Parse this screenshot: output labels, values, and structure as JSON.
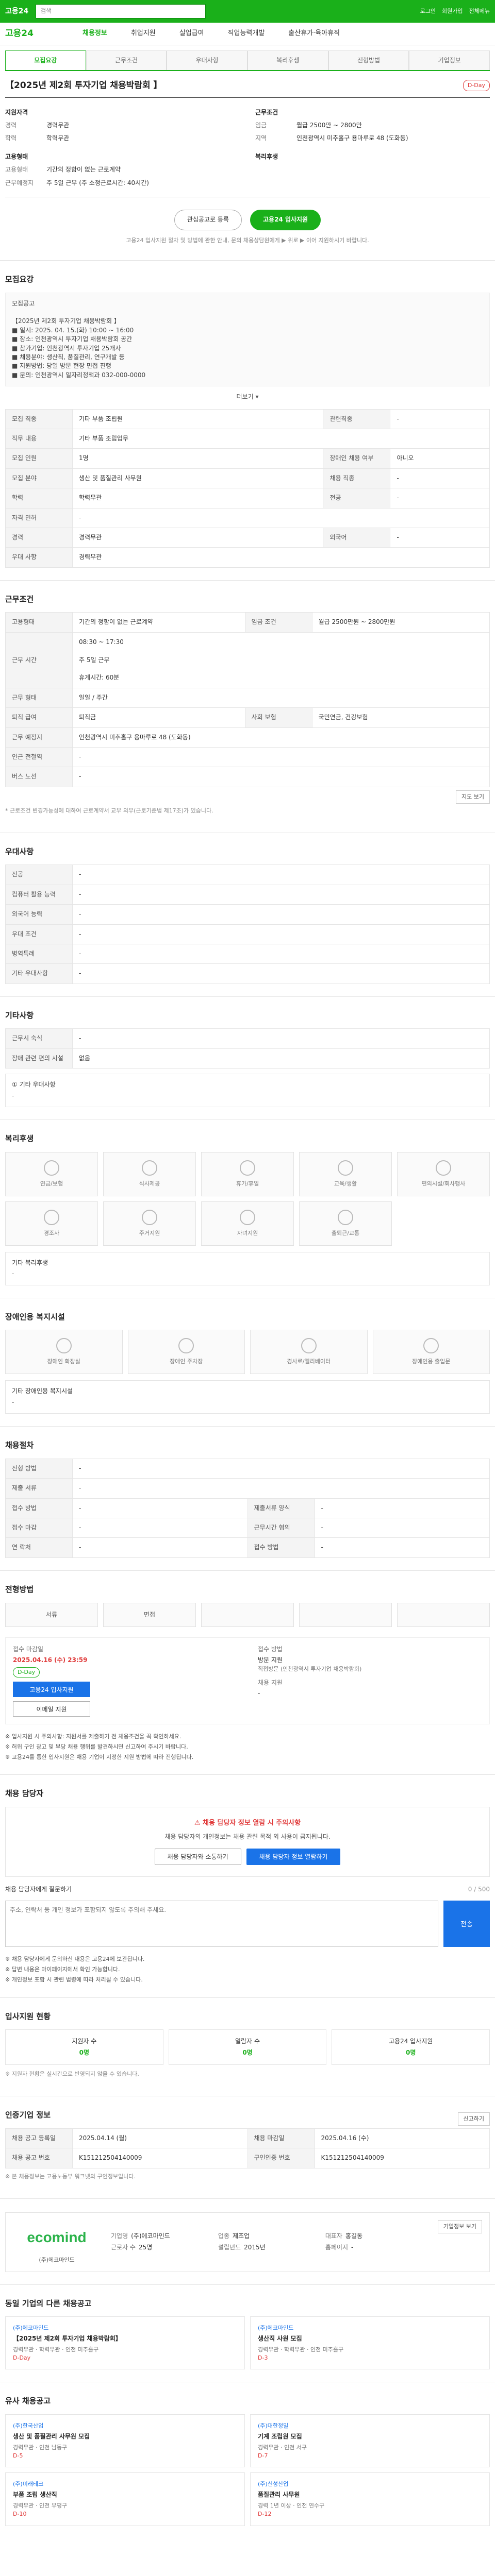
{
  "topbar": {
    "logo": "고용24",
    "search_placeholder": "검색",
    "links": [
      "로그인",
      "회원가입",
      "전체메뉴"
    ]
  },
  "gnb": {
    "logo": "고용24",
    "items": [
      "채용정보",
      "취업지원",
      "실업급여",
      "직업능력개발",
      "출산휴가·육아휴직"
    ],
    "active": 0
  },
  "tabs": [
    "모집요강",
    "근무조건",
    "우대사항",
    "복리후생",
    "전형방법",
    "기업정보"
  ],
  "headline": {
    "title": "【2025년 제2회 투자기업 채용박람회 】",
    "badge": "D-Day"
  },
  "summary": {
    "left_title": "지원자격",
    "left": [
      {
        "k": "경력",
        "v": "경력무관"
      },
      {
        "k": "학력",
        "v": "학력무관"
      }
    ],
    "left2_title": "고용형태",
    "left2": [
      {
        "k": "고용형태",
        "v": "기간의 정함이 없는 근로계약"
      },
      {
        "k": "근무예정지",
        "v": "주 5일 근무 (주 소정근로시간: 40시간)"
      }
    ],
    "right_title": "근무조건",
    "right": [
      {
        "k": "임금",
        "v": "월급 2500만 ~ 2800만"
      },
      {
        "k": "지역",
        "v": "인천광역시 미추홀구 용마루로 48 (도화동)"
      }
    ],
    "right2_title": "복리후생",
    "right2": []
  },
  "actions": {
    "save": "관심공고로 등록",
    "apply": "고용24 입사지원"
  },
  "actions_note": "고용24 입사지원 절차 및 방법에 관한 안내, 문의 채용상담원에게 ▶ 위로 ▶ 이어 지원하시기 바랍니다.",
  "recruit": {
    "title": "모집요강",
    "content": "모집공고\n\n【2025년 제2회 투자기업 채용박람회 】\n■ 일시: 2025. 04. 15.(화) 10:00 ~ 16:00\n■ 장소: 인천광역시 투자기업 채용박람회 공간\n■ 참가기업: 인천광역시 투자기업 25개사\n■ 채용분야: 생산직, 품질관리, 연구개발 등\n■ 지원방법: 당일 방문 현장 면접 진행\n■ 문의: 인천광역시 일자리정책과 032-000-0000",
    "more": "더보기 ▾",
    "rows": [
      {
        "k": "모집 직종",
        "v": "기타 부품 조립원",
        "k2": "관련직종",
        "v2": "-"
      },
      {
        "k": "직무 내용",
        "v": "기타 부품 조립업무",
        "k2": "",
        "v2": ""
      },
      {
        "k": "모집 인원",
        "v": "1명",
        "k2": "장애인 채용 여부",
        "v2": "아니오"
      },
      {
        "k": "모집 분야",
        "v": "생산 및 품질관리 사무원",
        "k2": "채용 직종",
        "v2": "-"
      },
      {
        "k": "학력",
        "v": "학력무관",
        "k2": "전공",
        "v2": "-"
      },
      {
        "k": "자격 면허",
        "v": "-",
        "k2": "",
        "v2": ""
      },
      {
        "k": "경력",
        "v": "경력무관",
        "k2": "외국어",
        "v2": "-"
      },
      {
        "k": "우대 사항",
        "v": "경력무관",
        "k2": "",
        "v2": ""
      }
    ]
  },
  "work": {
    "title": "근무조건",
    "rows": [
      {
        "k": "고용형태",
        "v": "기간의 정함이 없는 근로계약",
        "k2": "임금 조건",
        "v2": "월급 2500만원 ~ 2800만원"
      },
      {
        "k": "근무 시간",
        "v": "08:30 ~ 17:30\n\n주 5일 근무\n\n휴게시간: 60분",
        "k2": "",
        "v2": ""
      },
      {
        "k": "근무 형태",
        "v": "일일 / 주간",
        "k2": "",
        "v2": ""
      },
      {
        "k": "퇴직 급여",
        "v": "퇴직금",
        "k2": "사회 보험",
        "v2": "국민연금, 건강보험"
      },
      {
        "k": "근무 예정지",
        "v": "인천광역시 미추홀구 용마루로 48 (도화동)",
        "k2": "",
        "v2": ""
      },
      {
        "k": "인근 전철역",
        "v": "-",
        "k2": "",
        "v2": ""
      },
      {
        "k": "버스 노선",
        "v": "-",
        "k2": "",
        "v2": ""
      }
    ],
    "map_btn": "지도 보기",
    "note": "* 근로조건 변경가능성에 대하여 근로계약서 교부 의무(근로기준법 제17조)가 있습니다."
  },
  "pref": {
    "title": "우대사항",
    "rows": [
      {
        "k": "전공",
        "v": "-"
      },
      {
        "k": "컴퓨터 활용 능력",
        "v": "-"
      },
      {
        "k": "외국어 능력",
        "v": "-"
      },
      {
        "k": "우대 조건",
        "v": "-"
      },
      {
        "k": "병역특례",
        "v": "-"
      },
      {
        "k": "기타 우대사항",
        "v": "-"
      }
    ]
  },
  "extra": {
    "title": "기타사항",
    "rows": [
      {
        "k": "근무시 숙식",
        "v": "-"
      },
      {
        "k": "장애 관련 편의 시설",
        "v": "없음"
      }
    ],
    "sub": "① 기타 우대사항",
    "sub_val": "-"
  },
  "welfare": {
    "title": "복리후생",
    "icons": [
      "연금/보험",
      "식사제공",
      "휴가/휴일",
      "교육/생활",
      "편의시설/회사행사",
      "경조사",
      "주거지원",
      "자녀지원",
      "출퇴근/교통"
    ],
    "detail_label": "기타 복리후생",
    "detail": "-"
  },
  "disability": {
    "title": "장애인용 복지시설",
    "icons": [
      "장애인 화장실",
      "장애인 주차장",
      "경사로/엘리베이터",
      "장애인용 출입문"
    ],
    "detail_label": "기타 장애인용 복지시설",
    "detail": "-"
  },
  "process": {
    "title": "채용절차",
    "rows": [
      {
        "k": "전형 방법",
        "v": "-",
        "k2": "",
        "v2": ""
      },
      {
        "k": "제출 서류",
        "v": "-",
        "k2": "",
        "v2": ""
      },
      {
        "k": "접수 방법",
        "v": "-",
        "k2": "제출서류 양식",
        "v2": "-"
      },
      {
        "k": "접수 마감",
        "v": "-",
        "k2": "근무시간 협의",
        "v2": "-"
      },
      {
        "k": "연 락처",
        "v": "-",
        "k2": "접수 방법",
        "v2": "-"
      }
    ]
  },
  "steps": {
    "title": "전형방법",
    "items": [
      "서류",
      "면접",
      "",
      "",
      ""
    ]
  },
  "period": {
    "title": "접수 마감일",
    "deadline": "2025.04.16 (수) 23:59",
    "dday": "D-Day",
    "apply": "고용24 입사지원",
    "email": "이메일 지원",
    "date_label": "마감 시간",
    "date_val": "-",
    "title2": "접수 방법",
    "method": "방문 지원",
    "method_desc": "직접방문 (인천광역시 투자기업 채용박람회)",
    "ref_label": "채용 지원",
    "ref_val": "-"
  },
  "notice": [
    "※ 입사지원 시 주의사항: 지원서를 제출하기 전 채용조건을 꼭 확인하세요.",
    "※ 허위 구인 광고 및 부당 채용 행위를 발견하시면 신고하여 주시기 바랍니다.",
    "※ 고용24를 통한 입사지원은 채용 기업이 지정한 지원 방법에 따라 진행됩니다."
  ],
  "inquiry": {
    "title": "채용 담당자",
    "warn_title": "⚠ 채용 담당자 정보 열람 시 주의사항",
    "warn_text": "채용 담당자의 개인정보는 채용 관련 목적 외 사용이 금지됩니다.",
    "btn1": "채용 담당자와 소통하기",
    "btn2": "채용 담당자 정보 열람하기",
    "chat_label": "채용 담당자에게 질문하기",
    "chat_placeholder": "주소, 연락처 등 개인 정보가 포함되지 않도록 주의해 주세요.",
    "chat_count": "0 / 500",
    "send": "전송",
    "list": [
      "※ 채용 담당자에게 문의하신 내용은 고용24에 보관됩니다.",
      "※ 답변 내용은 마이페이지에서 확인 가능합니다.",
      "※ 개인정보 포함 시 관련 법령에 따라 처리될 수 있습니다."
    ]
  },
  "docs": {
    "title": "입사지원 현황",
    "items": [
      {
        "label": "지원자 수",
        "cnt": "0명"
      },
      {
        "label": "열람자 수",
        "cnt": "0명"
      },
      {
        "label": "고용24 입사지원",
        "cnt": "0명"
      }
    ],
    "note": "※ 지원자 현황은 실시간으로 반영되지 않을 수 있습니다."
  },
  "recruit_info": {
    "title": "인증기업 정보",
    "btn": "신고하기",
    "rows": [
      {
        "k": "채용 공고 등록일",
        "v": "2025.04.14 (월)",
        "k2": "채용 마감일",
        "v2": "2025.04.16 (수)"
      },
      {
        "k": "채용 공고 번호",
        "v": "K151212504140009",
        "k2": "구인인증 번호",
        "v2": "K151212504140009"
      }
    ],
    "note": "※ 본 채용정보는 고용노동부 워크넷의 구인정보입니다."
  },
  "company": {
    "logo": "ecomind",
    "name": "(주)에코마인드",
    "btn": "기업정보 보기",
    "info": [
      {
        "k": "기업명",
        "v": "(주)에코마인드"
      },
      {
        "k": "업종",
        "v": "제조업"
      },
      {
        "k": "대표자",
        "v": "홍길동"
      },
      {
        "k": "근로자 수",
        "v": "25명"
      },
      {
        "k": "설립년도",
        "v": "2015년"
      },
      {
        "k": "홈페이지",
        "v": "-"
      }
    ]
  },
  "same_company": {
    "title": "동일 기업의 다른 채용공고",
    "jobs": [
      {
        "co": "(주)에코마인드",
        "title": "【2025년 제2회 투자기업 채용박람회】",
        "meta": "경력무관 · 학력무관 · 인천 미추홀구",
        "tag": "D-Day"
      },
      {
        "co": "(주)에코마인드",
        "title": "생산직 사원 모집",
        "meta": "경력무관 · 학력무관 · 인천 미추홀구",
        "tag": "D-3"
      }
    ]
  },
  "similar": {
    "title": "유사 채용공고",
    "jobs": [
      {
        "co": "(주)한국산업",
        "title": "생산 및 품질관리 사무원 모집",
        "meta": "경력무관 · 인천 남동구",
        "tag": "D-5"
      },
      {
        "co": "(주)대한정밀",
        "title": "기계 조립원 모집",
        "meta": "경력무관 · 인천 서구",
        "tag": "D-7"
      },
      {
        "co": "(주)미래테크",
        "title": "부품 조립 생산직",
        "meta": "경력무관 · 인천 부평구",
        "tag": "D-10"
      },
      {
        "co": "(주)신성산업",
        "title": "품질관리 사무원",
        "meta": "경력 1년 이상 · 인천 연수구",
        "tag": "D-12"
      }
    ]
  }
}
